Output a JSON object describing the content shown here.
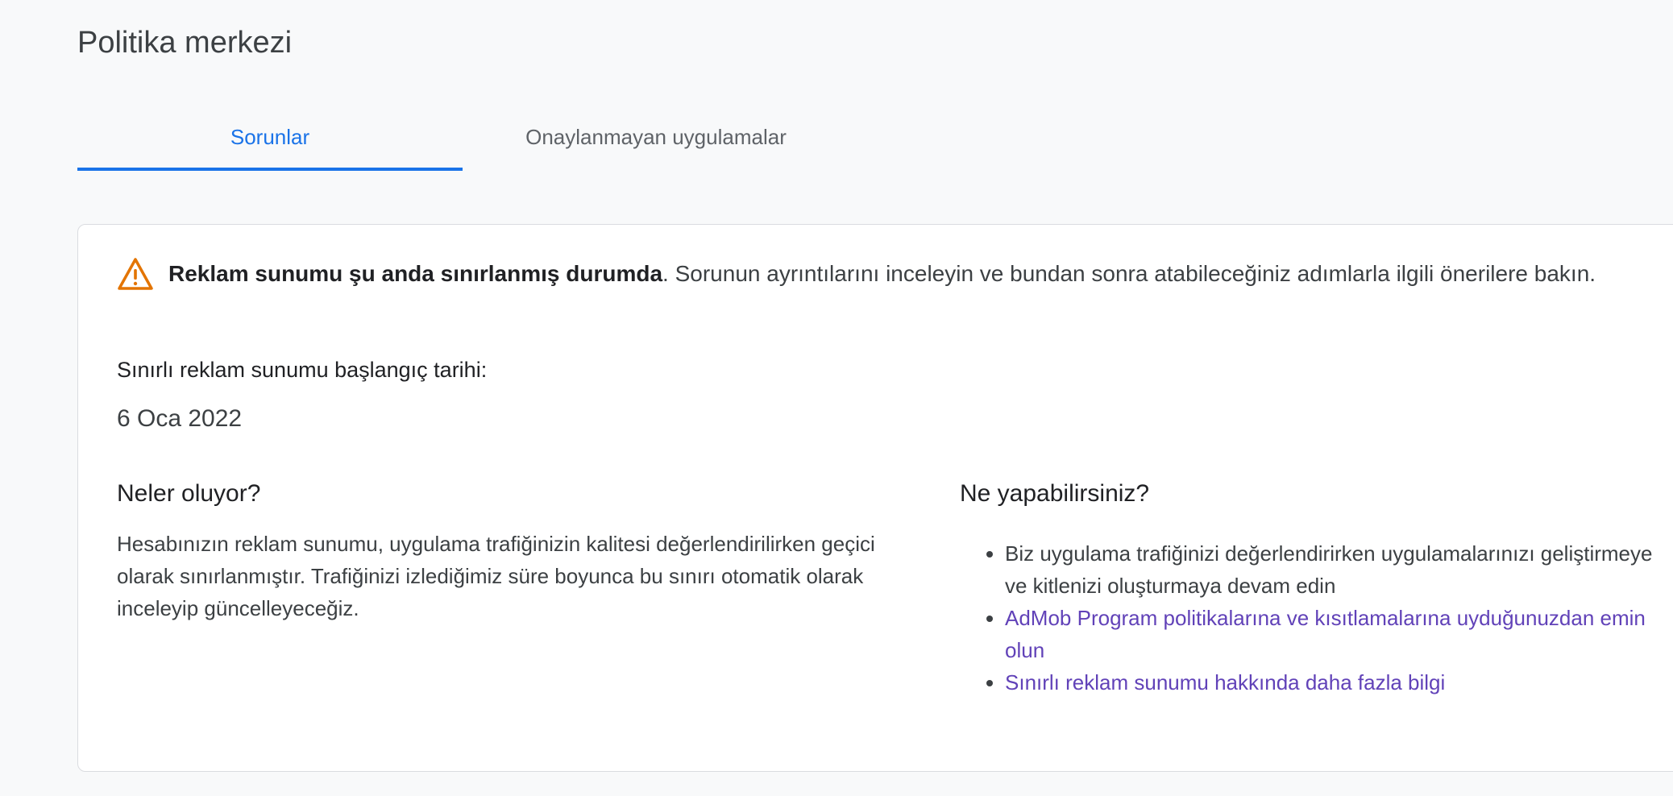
{
  "header": {
    "title": "Politika merkezi"
  },
  "tabs": [
    {
      "label": "Sorunlar",
      "active": true
    },
    {
      "label": "Onaylanmayan uygulamalar",
      "active": false
    }
  ],
  "alert": {
    "icon": "warning-icon",
    "bold": "Reklam sunumu şu anda sınırlanmış durumda",
    "rest": ". Sorunun ayrıntılarını inceleyin ve bundan sonra atabileceğiniz adımlarla ilgili önerilere bakın."
  },
  "limited": {
    "label": "Sınırlı reklam sunumu başlangıç tarihi:",
    "date": "6 Oca 2022"
  },
  "what": {
    "heading": "Neler oluyor?",
    "body": "Hesabınızın reklam sunumu, uygulama trafiğinizin kalitesi değerlendirilirken geçici olarak sınırlanmıştır. Trafiğinizi izlediğimiz süre boyunca bu sınırı otomatik olarak inceleyip güncelleyeceğiz."
  },
  "todo": {
    "heading": "Ne yapabilirsiniz?",
    "items": [
      {
        "text": "Biz uygulama trafiğinizi değerlendirirken uygulamalarınızı geliştirmeye ve kitlenizi oluşturmaya devam edin"
      },
      {
        "text": "AdMob Program politikalarına ve kısıtlamalarına uyduğunuzdan emin olun"
      },
      {
        "text": "Sınırlı reklam sunumu hakkında daha fazla bilgi"
      }
    ]
  },
  "colors": {
    "accent": "#1a73e8",
    "link": "#6142b8",
    "warning": "#e37400"
  }
}
